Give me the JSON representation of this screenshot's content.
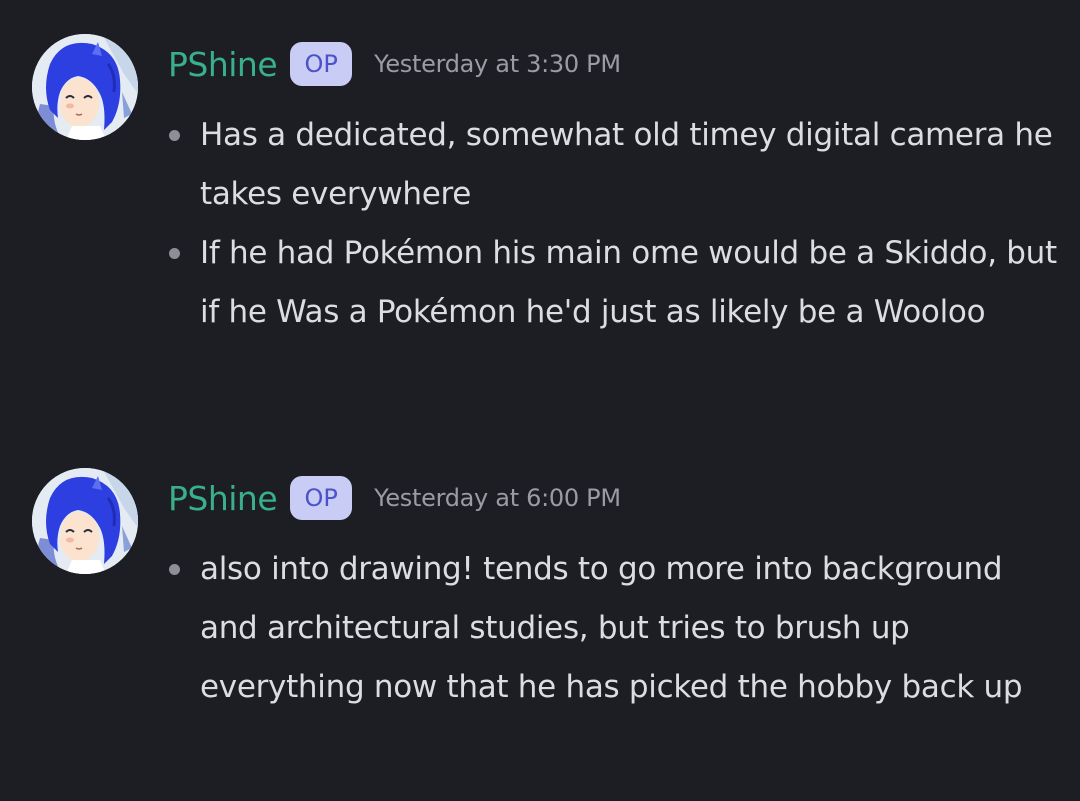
{
  "messages": [
    {
      "author": "PShine",
      "badge": "OP",
      "timestamp": "Yesterday at 3:30 PM",
      "bullets": [
        "Has a dedicated, somewhat old timey digital camera he takes everywhere",
        "If he had Pokémon his main ome would be a Skiddo, but if he Was a Pokémon he'd just as likely be a Wooloo"
      ]
    },
    {
      "author": "PShine",
      "badge": "OP",
      "timestamp": "Yesterday at 6:00 PM",
      "bullets": [
        "also into drawing! tends to go more into background and architectural studies, but tries to brush up everything now that he has picked the hobby back up"
      ]
    }
  ],
  "colors": {
    "background": "#1d1e23",
    "username": "#38b18a",
    "badge_bg": "#c9ccf5",
    "badge_text": "#4a54c8",
    "timestamp": "#9a9ba3",
    "message_text": "#dcdde0"
  },
  "icons": {
    "avatar": "avatar-image",
    "bullet": "bullet-dot-icon"
  }
}
